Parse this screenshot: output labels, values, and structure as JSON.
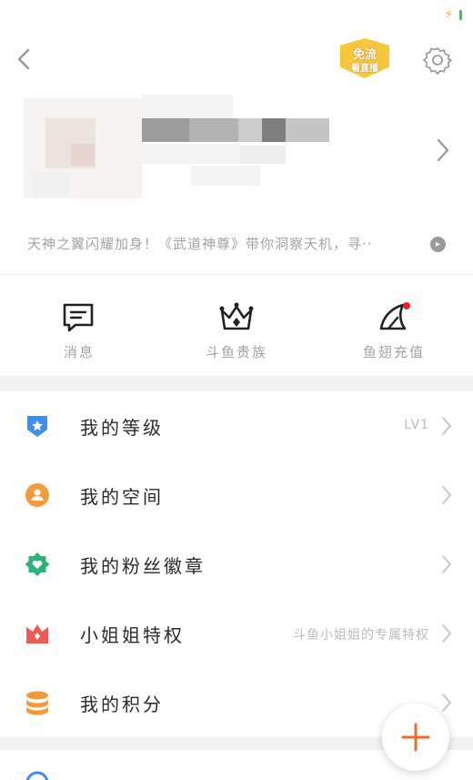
{
  "announcement": "天神之翼闪耀加身！《武道神尊》带你洞察天机，寻··",
  "promo_badge": {
    "line1": "免流",
    "line2": "看直播"
  },
  "quick_actions": [
    {
      "label": "消息",
      "icon": "message-icon"
    },
    {
      "label": "斗鱼贵族",
      "icon": "crown-icon"
    },
    {
      "label": "鱼翅充值",
      "icon": "fin-icon",
      "has_badge": true
    }
  ],
  "menu": [
    {
      "label": "我的等级",
      "value": "LV1",
      "icon": "level-shield-icon",
      "color": "#3d8ef0"
    },
    {
      "label": "我的空间",
      "value": "",
      "icon": "space-person-icon",
      "color": "#f39a3c"
    },
    {
      "label": "我的粉丝徽章",
      "value": "",
      "icon": "fan-badge-icon",
      "color": "#2bb37a"
    },
    {
      "label": "小姐姐特权",
      "value": "斗鱼小姐姐的专属特权",
      "icon": "privilege-crown-icon",
      "color": "#ee5a54"
    },
    {
      "label": "我的积分",
      "value": "",
      "icon": "points-coins-icon",
      "color": "#f29a3a"
    }
  ],
  "colors": {
    "accent": "#f26a2e",
    "notification": "#e8232d",
    "muted_text": "#a3a3a3"
  }
}
